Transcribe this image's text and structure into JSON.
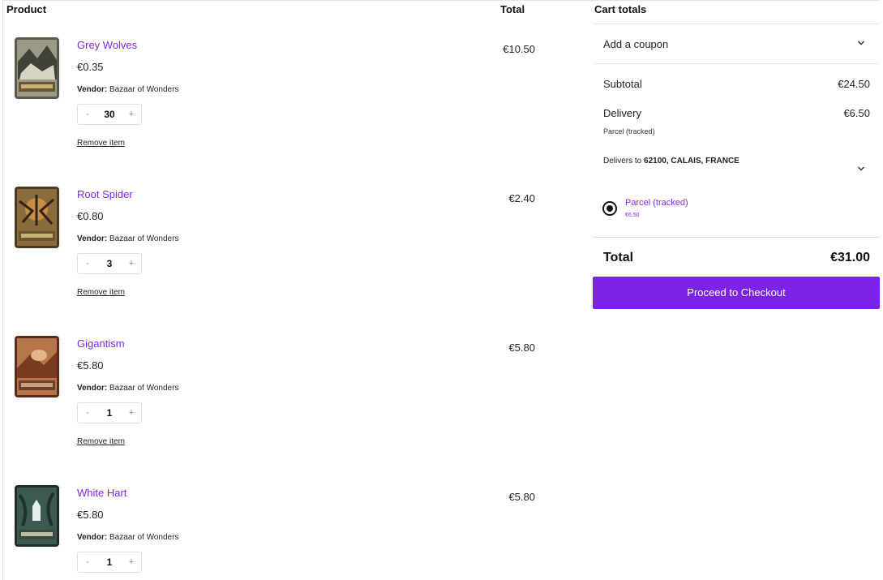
{
  "headers": {
    "product": "Product",
    "total": "Total"
  },
  "labels": {
    "vendor": "Vendor:",
    "remove": "Remove item"
  },
  "products": [
    {
      "name": "Grey Wolves",
      "price": "€0.35",
      "vendor": "Bazaar of Wonders",
      "qty": "30",
      "total": "€10.50"
    },
    {
      "name": "Root Spider",
      "price": "€0.80",
      "vendor": "Bazaar of Wonders",
      "qty": "3",
      "total": "€2.40"
    },
    {
      "name": "Gigantism",
      "price": "€5.80",
      "vendor": "Bazaar of Wonders",
      "qty": "1",
      "total": "€5.80"
    },
    {
      "name": "White Hart",
      "price": "€5.80",
      "vendor": "Bazaar of Wonders",
      "qty": "1",
      "total": "€5.80"
    }
  ],
  "cart": {
    "heading": "Cart totals",
    "coupon": "Add a coupon",
    "subtotal_label": "Subtotal",
    "subtotal": "€24.50",
    "delivery_label": "Delivery",
    "delivery": "€6.50",
    "delivery_method": "Parcel (tracked)",
    "delivers_to_prefix": "Delivers to",
    "delivers_to": "62100, CALAIS, FRANCE",
    "option_label": "Parcel (tracked)",
    "option_price": "€6.50",
    "total_label": "Total",
    "total": "€31.00",
    "checkout": "Proceed to Checkout"
  },
  "icons": {
    "quantity_minus": "minus-icon",
    "quantity_plus": "plus-icon",
    "expand": "chevron-down-icon"
  },
  "colors": {
    "accent": "#7b23e6",
    "link": "#7f28e8"
  }
}
